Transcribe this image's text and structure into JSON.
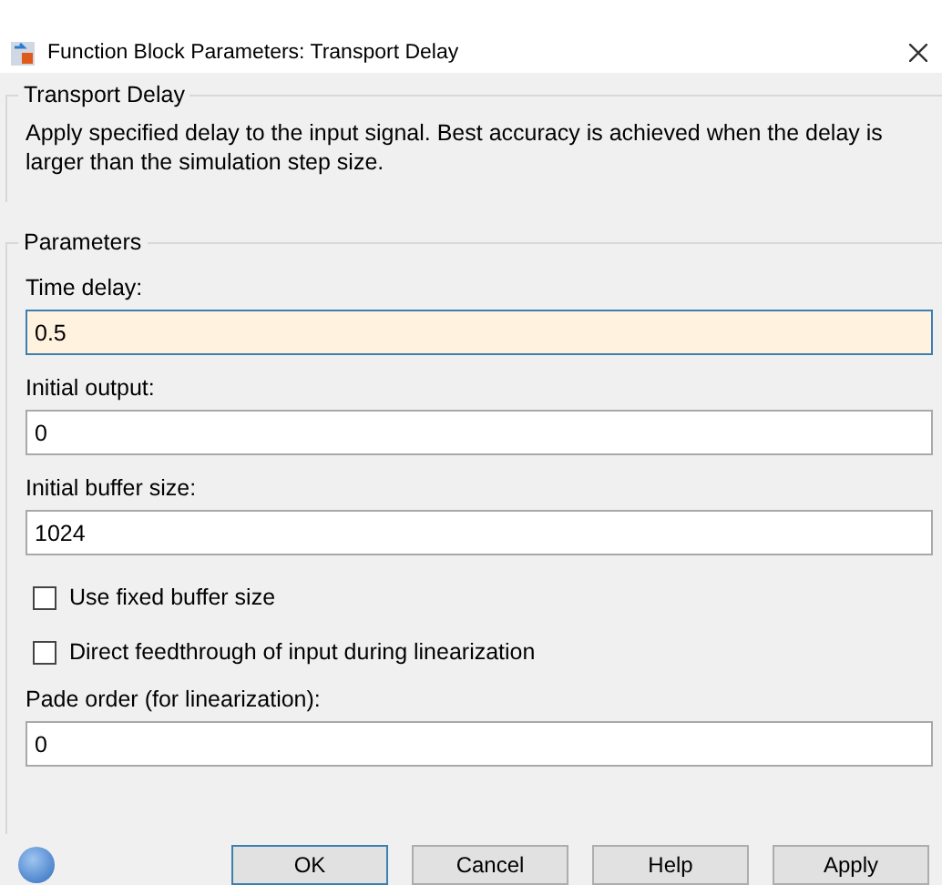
{
  "window": {
    "title": "Function Block Parameters: Transport Delay"
  },
  "description_group": {
    "title": "Transport Delay",
    "text": "Apply specified delay to the input signal.  Best accuracy is achieved when the delay is larger than the simulation step size."
  },
  "parameters": {
    "title": "Parameters",
    "items": [
      {
        "kind": "field",
        "label": "Time delay:",
        "value": "0.5",
        "focused": true
      },
      {
        "kind": "field",
        "label": "Initial output:",
        "value": "0",
        "focused": false
      },
      {
        "kind": "field",
        "label": "Initial buffer size:",
        "value": "1024",
        "focused": false
      },
      {
        "kind": "checkbox",
        "label": "Use fixed buffer size",
        "checked": false
      },
      {
        "kind": "checkbox",
        "label": "Direct feedthrough of input during linearization",
        "checked": false
      },
      {
        "kind": "field",
        "label": "Pade order (for linearization):",
        "value": "0",
        "focused": false
      }
    ]
  },
  "buttons": [
    {
      "label": "OK",
      "default": true
    },
    {
      "label": "Cancel",
      "default": false
    },
    {
      "label": "Help",
      "default": false
    },
    {
      "label": "Apply",
      "default": false
    }
  ]
}
